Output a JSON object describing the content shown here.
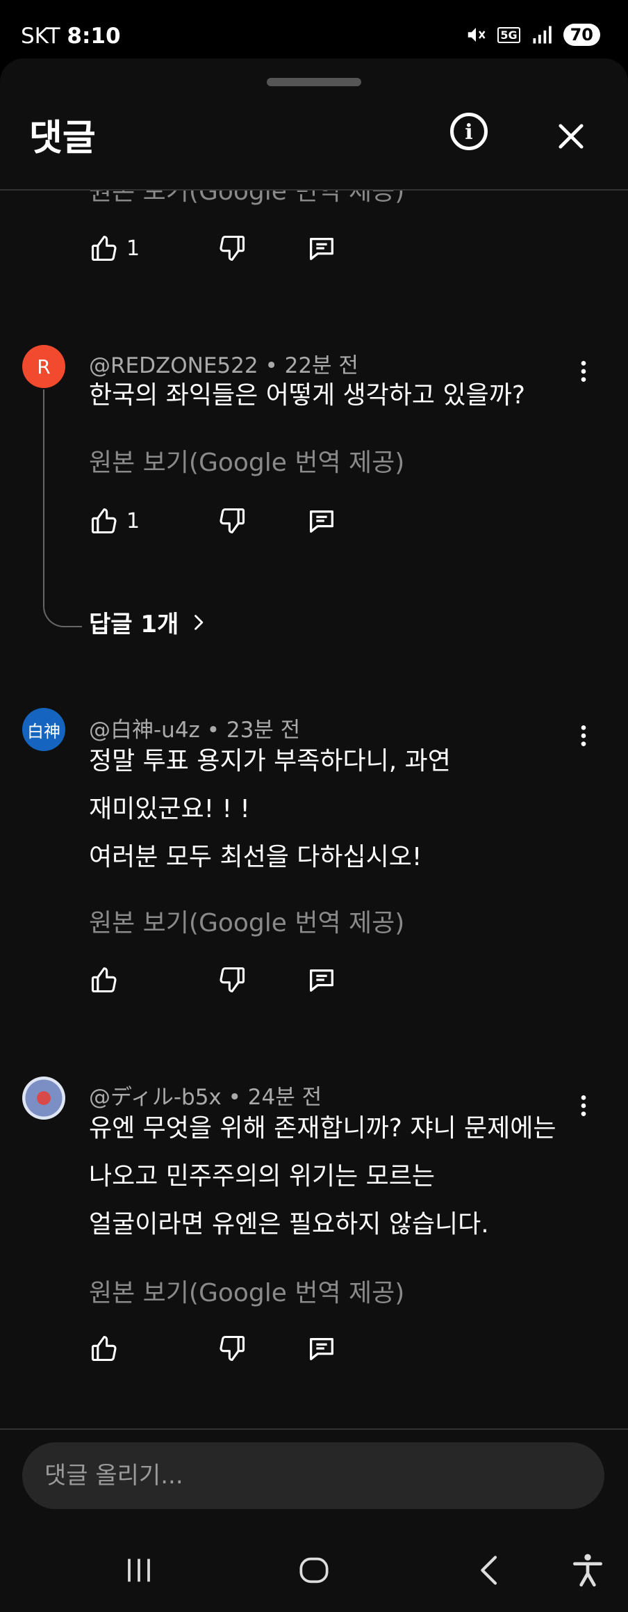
{
  "status_bar": {
    "carrier": "SKT",
    "time": "8:10",
    "network": "5G",
    "battery": "70",
    "icons": [
      "mute-icon",
      "5g-icon",
      "signal-icon",
      "battery-icon"
    ]
  },
  "sheet": {
    "title": "댓글",
    "icons": [
      "info-icon",
      "close-icon"
    ]
  },
  "list": {
    "cut_translate": "원본 보기(Google 번역 제공)",
    "top_actions": {
      "likes": "1"
    },
    "comments": [
      {
        "avatar_text": "R",
        "avatar_color": "#f24a2f",
        "author": "@REDZONE522",
        "time": "22분 전",
        "lines": [
          "한국의 좌익들은 어떻게 생각하고 있을까?"
        ],
        "translate": "원본 보기(Google 번역 제공)",
        "likes": "1",
        "replies": "답글 1개"
      },
      {
        "avatar_text": "白神",
        "avatar_color": "#1565c0",
        "author": "@白神-u4z",
        "time": "23분 전",
        "lines": [
          "정말 투표 용지가 부족하다니, 과연",
          "재미있군요! ! !",
          "여러분 모두 최선을 다하십시오!"
        ],
        "translate": "원본 보기(Google 번역 제공)",
        "likes": ""
      },
      {
        "avatar_text": "",
        "avatar_color": "#7b8fc4",
        "author": "@ディル-b5x",
        "time": "24분 전",
        "lines": [
          "유엔 무엇을 위해 존재합니까? 쟈니 문제에는",
          "나오고 민주주의의 위기는 모르는",
          "얼굴이라면 유엔은 필요하지 않습니다."
        ],
        "translate": "원본 보기(Google 번역 제공)",
        "likes": ""
      }
    ]
  },
  "composer": {
    "placeholder": "댓글 올리기..."
  },
  "nav": {
    "icons": [
      "recents-icon",
      "home-icon",
      "back-icon",
      "accessibility-icon"
    ]
  },
  "colors": {
    "background": "#0f0f0f",
    "secondary_text": "#aaaaaa",
    "input_bg": "#272727"
  }
}
